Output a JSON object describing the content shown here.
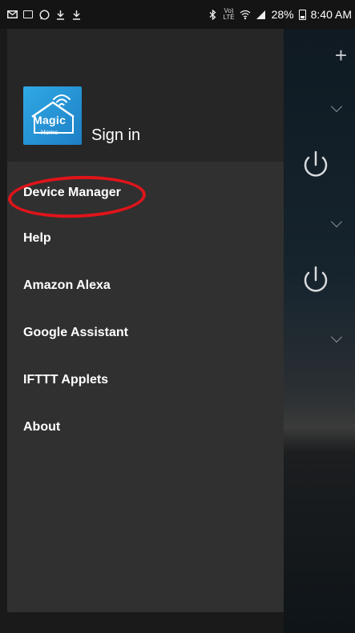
{
  "status_bar": {
    "battery_text": "28%",
    "time": "8:40 AM",
    "network_label_top": "Vo)",
    "network_label_bottom": "LTE",
    "icons": [
      "mail-icon",
      "notification-icon",
      "whatsapp-icon",
      "download-icon",
      "download-icon",
      "bluetooth-icon",
      "wifi-icon",
      "signal-icon",
      "battery-icon"
    ]
  },
  "drawer": {
    "header": {
      "logo_brand": "Magic",
      "logo_sub": "Home",
      "sign_in_label": "Sign in"
    },
    "items": [
      {
        "label": "Device Manager"
      },
      {
        "label": "Help"
      },
      {
        "label": "Amazon Alexa"
      },
      {
        "label": "Google Assistant"
      },
      {
        "label": "IFTTT Applets"
      },
      {
        "label": "About"
      }
    ]
  },
  "background_app": {
    "add_label": "+"
  },
  "colors": {
    "drawer_bg": "#303030",
    "header_bg": "#262626",
    "logo_blue": "#2fa9e4",
    "annotation_red": "#e0141a"
  }
}
